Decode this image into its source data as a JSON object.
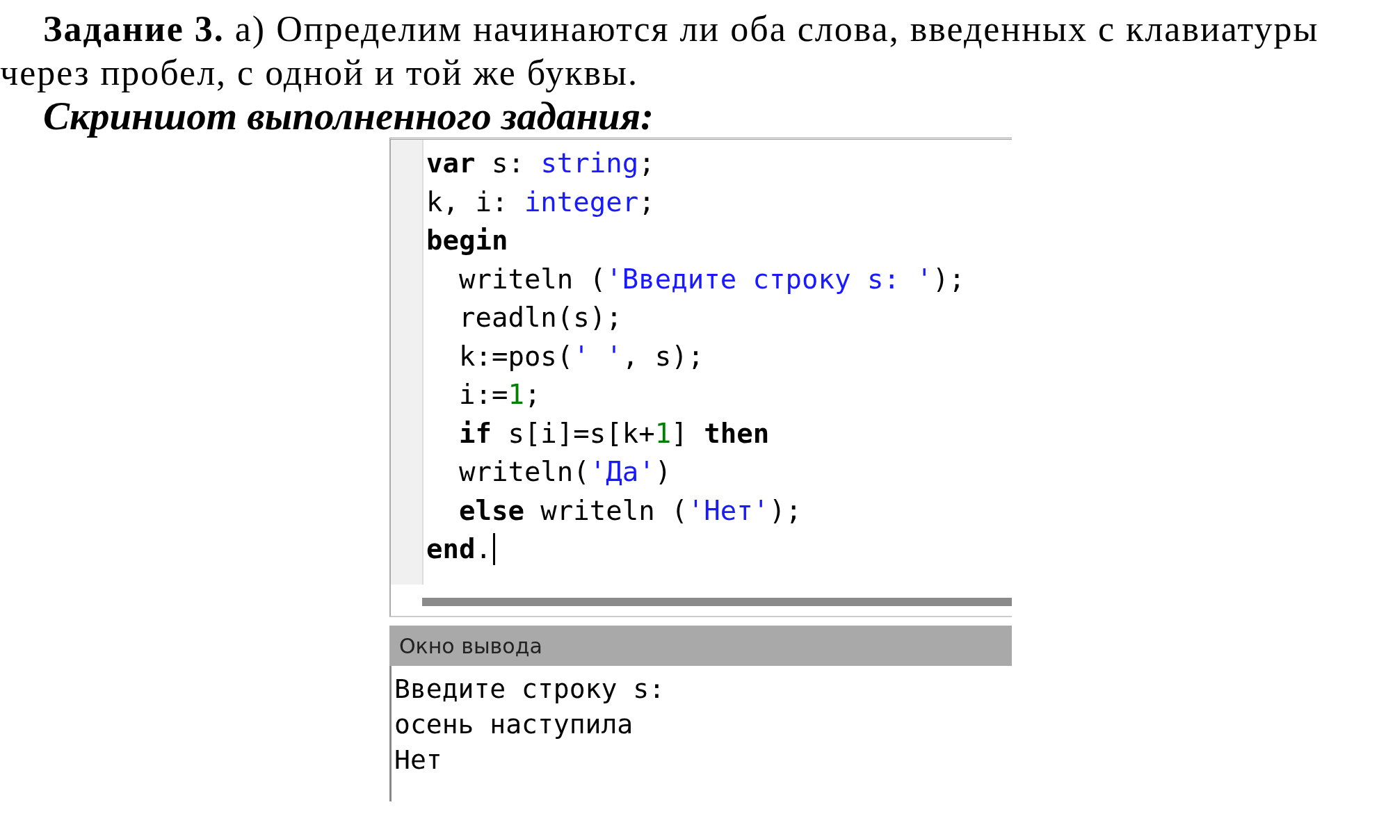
{
  "task": {
    "text": "**Задание 3.** а) Определим начинаются ли оба слова, введенных с клавиатуры через пробел, с одной и той же буквы."
  },
  "caption": "Скриншот выполненного задания:",
  "editor": {
    "lines": [
      {
        "tokens": [
          {
            "kind": "kw",
            "text": "var"
          },
          {
            "kind": "plain",
            "text": " s: "
          },
          {
            "kind": "type",
            "text": "string"
          },
          {
            "kind": "plain",
            "text": ";"
          }
        ]
      },
      {
        "tokens": [
          {
            "kind": "plain",
            "text": "k, i: "
          },
          {
            "kind": "type",
            "text": "integer"
          },
          {
            "kind": "plain",
            "text": ";"
          }
        ]
      },
      {
        "tokens": [
          {
            "kind": "kw",
            "text": "begin"
          }
        ]
      },
      {
        "tokens": [
          {
            "kind": "plain",
            "text": "  writeln ("
          },
          {
            "kind": "str",
            "text": "'Введите строку s: '"
          },
          {
            "kind": "plain",
            "text": ");"
          }
        ]
      },
      {
        "tokens": [
          {
            "kind": "plain",
            "text": "  readln(s);"
          }
        ]
      },
      {
        "tokens": [
          {
            "kind": "plain",
            "text": "  k:=pos("
          },
          {
            "kind": "str",
            "text": "' '"
          },
          {
            "kind": "plain",
            "text": ", s);"
          }
        ]
      },
      {
        "tokens": [
          {
            "kind": "plain",
            "text": "  i:="
          },
          {
            "kind": "num",
            "text": "1"
          },
          {
            "kind": "plain",
            "text": ";"
          }
        ]
      },
      {
        "tokens": [
          {
            "kind": "kw",
            "text": "  if"
          },
          {
            "kind": "plain",
            "text": " s[i]=s[k+"
          },
          {
            "kind": "num",
            "text": "1"
          },
          {
            "kind": "plain",
            "text": "] "
          },
          {
            "kind": "kw",
            "text": "then"
          }
        ]
      },
      {
        "tokens": [
          {
            "kind": "plain",
            "text": "  writeln("
          },
          {
            "kind": "str",
            "text": "'Да'"
          },
          {
            "kind": "plain",
            "text": ")"
          }
        ]
      },
      {
        "tokens": [
          {
            "kind": "kw",
            "text": "  else"
          },
          {
            "kind": "plain",
            "text": " writeln ("
          },
          {
            "kind": "str",
            "text": "'Нет'"
          },
          {
            "kind": "plain",
            "text": ");"
          }
        ]
      },
      {
        "cursor": true,
        "tokens": [
          {
            "kind": "kw",
            "text": "end"
          },
          {
            "kind": "plain",
            "text": "."
          }
        ]
      }
    ]
  },
  "output": {
    "title": "Окно вывода",
    "lines": [
      "Введите строку s:",
      "осень наступила",
      "Нет"
    ]
  }
}
